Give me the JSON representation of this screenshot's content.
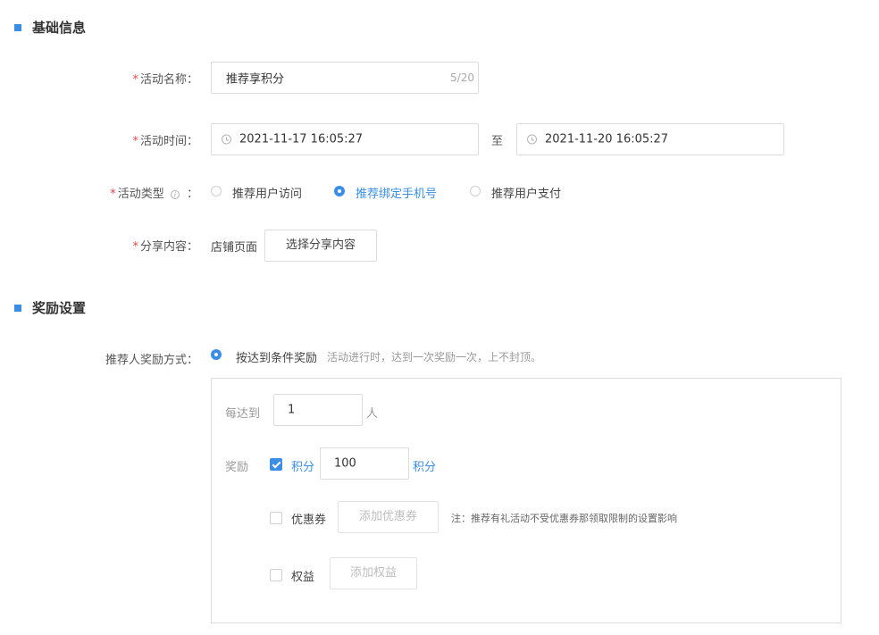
{
  "basic": {
    "title": "基础信息",
    "name_label": "活动名称：",
    "name_value": "推荐享积分",
    "name_counter": "5/20",
    "time_label": "活动时间：",
    "start_time": "2021-11-17 16:05:27",
    "to_text": "至",
    "end_time": "2021-11-20 16:05:27",
    "type_label": "活动类型",
    "type_colon": "：",
    "type_info_glyph": "i",
    "type_options": [
      "推荐用户访问",
      "推荐绑定手机号",
      "推荐用户支付"
    ],
    "type_selected_index": 1,
    "share_label": "分享内容：",
    "share_value": "店铺页面",
    "share_button": "选择分享内容"
  },
  "reward": {
    "title": "奖励设置",
    "method_label": "推荐人奖励方式：",
    "method_option": "按达到条件奖励",
    "method_desc": "活动进行时，达到一次奖励一次，上不封顶。",
    "every_label": "每达到",
    "every_value": "1",
    "every_unit": "人",
    "reward_label": "奖励",
    "points_label": "积分",
    "points_checked": true,
    "points_value": "100",
    "points_unit": "积分",
    "coupon_label": "优惠券",
    "coupon_checked": false,
    "coupon_button": "添加优惠券",
    "coupon_note": "注：推荐有礼活动不受优惠券那领取限制的设置影响",
    "rights_label": "权益",
    "rights_checked": false,
    "rights_button": "添加权益"
  },
  "required_mark": "*",
  "colors": {
    "accent": "#3a8ee6",
    "required": "#f04848",
    "border": "#dcdcdc"
  }
}
